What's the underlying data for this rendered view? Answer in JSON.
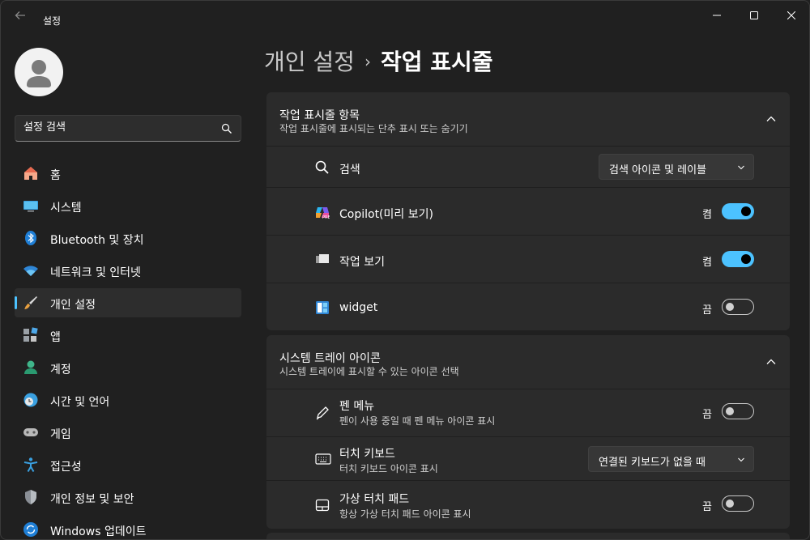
{
  "window": {
    "app_title": "설정",
    "back_icon": "back-arrow-icon",
    "controls": [
      "minimize-icon",
      "maximize-icon",
      "close-icon"
    ]
  },
  "sidebar": {
    "search": {
      "placeholder": "설정 검색",
      "icon": "search-icon"
    },
    "items": [
      {
        "label": "홈",
        "icon": "home-icon",
        "active": false
      },
      {
        "label": "시스템",
        "icon": "system-icon",
        "active": false
      },
      {
        "label": "Bluetooth 및 장치",
        "icon": "bluetooth-icon",
        "active": false
      },
      {
        "label": "네트워크 및 인터넷",
        "icon": "wifi-icon",
        "active": false
      },
      {
        "label": "개인 설정",
        "icon": "brush-icon",
        "active": true
      },
      {
        "label": "앱",
        "icon": "apps-icon",
        "active": false
      },
      {
        "label": "계정",
        "icon": "account-icon",
        "active": false
      },
      {
        "label": "시간 및 언어",
        "icon": "time-language-icon",
        "active": false
      },
      {
        "label": "게임",
        "icon": "gamepad-icon",
        "active": false
      },
      {
        "label": "접근성",
        "icon": "accessibility-icon",
        "active": false
      },
      {
        "label": "개인 정보 및 보안",
        "icon": "shield-icon",
        "active": false
      },
      {
        "label": "Windows 업데이트",
        "icon": "update-icon",
        "active": false
      }
    ]
  },
  "breadcrumb": {
    "parent": "개인 설정",
    "separator": "›",
    "current": "작업 표시줄"
  },
  "sections": [
    {
      "title": "작업 표시줄 항목",
      "subtitle": "작업 표시줄에 표시되는 단추 표시 또는 숨기기",
      "rows": [
        {
          "label": "검색",
          "icon": "search-icon",
          "control": "dropdown",
          "value": "검색 아이콘 및 레이블"
        },
        {
          "label": "Copilot(미리 보기)",
          "icon": "copilot-icon",
          "control": "toggle",
          "state": "켬",
          "on": true
        },
        {
          "label": "작업 보기",
          "icon": "task-view-icon",
          "control": "toggle",
          "state": "켬",
          "on": true
        },
        {
          "label": "widget",
          "icon": "widgets-icon",
          "control": "toggle",
          "state": "끔",
          "on": false
        }
      ]
    },
    {
      "title": "시스템 트레이 아이콘",
      "subtitle": "시스템 트레이에 표시할 수 있는 아이콘 선택",
      "rows": [
        {
          "label": "펜 메뉴",
          "sub": "펜이 사용 중일 때 펜 메뉴 아이콘 표시",
          "icon": "pen-icon",
          "control": "toggle",
          "state": "끔",
          "on": false
        },
        {
          "label": "터치 키보드",
          "sub": "터치 키보드 아이콘 표시",
          "icon": "keyboard-icon",
          "control": "dropdown",
          "value": "연결된 키보드가 없을 때"
        },
        {
          "label": "가상 터치 패드",
          "sub": "항상 가상 터치 패드 아이콘 표시",
          "icon": "touchpad-icon",
          "control": "toggle",
          "state": "끔",
          "on": false
        }
      ]
    }
  ],
  "colors": {
    "accent": "#4cc2ff",
    "background": "#202020",
    "card": "#2b2b2b"
  }
}
